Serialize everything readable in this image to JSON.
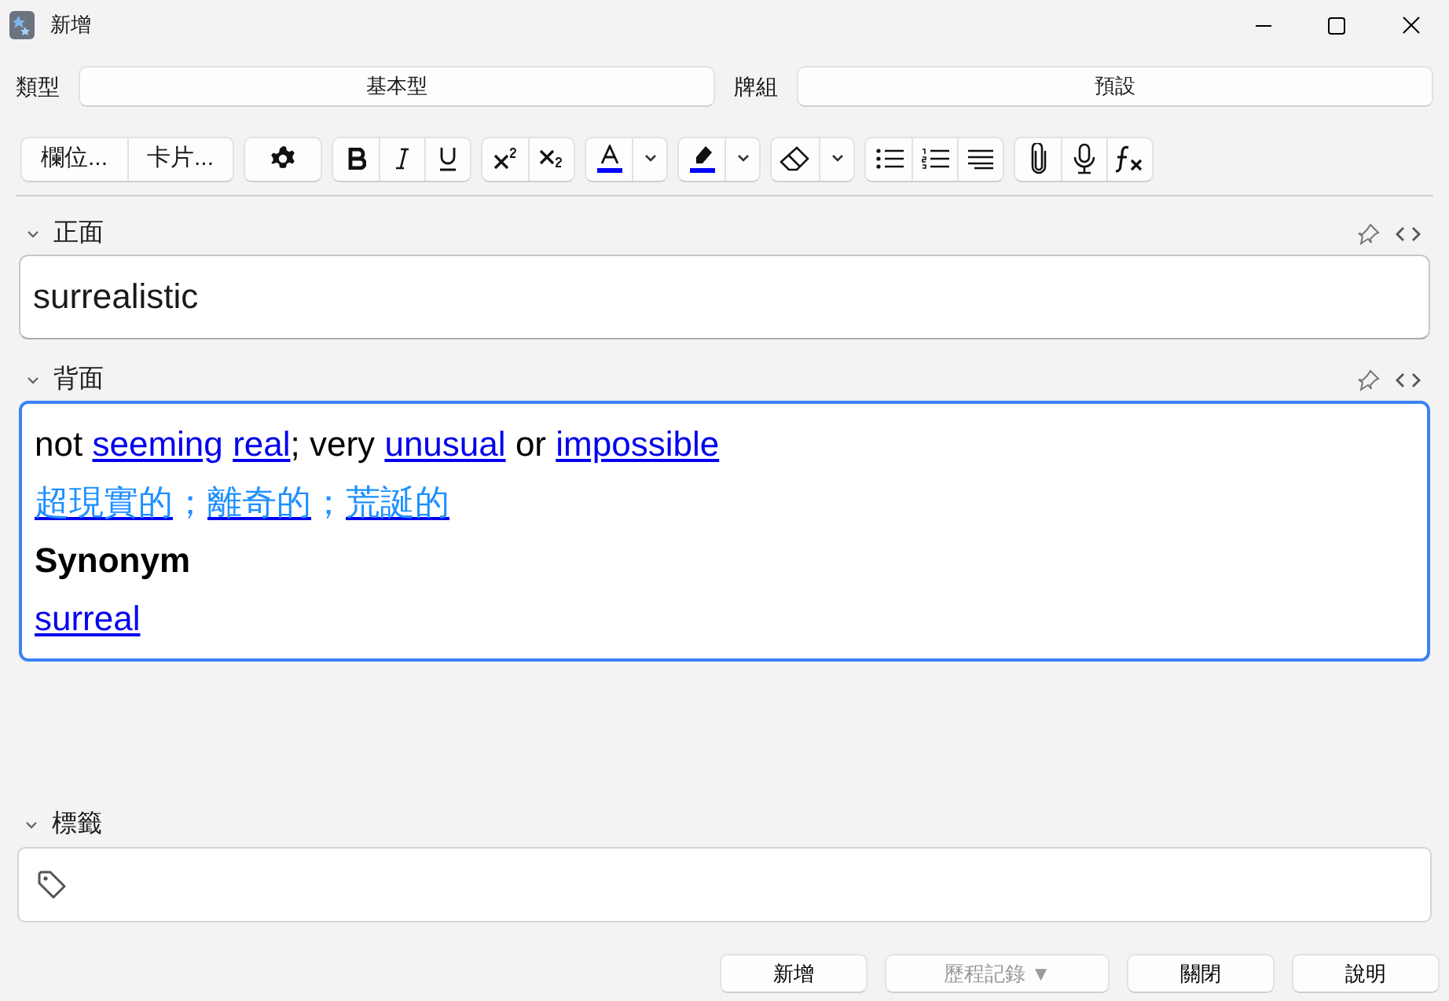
{
  "window": {
    "title": "新增"
  },
  "note_type": {
    "label": "類型",
    "value": "基本型"
  },
  "deck": {
    "label": "牌組",
    "value": "預設"
  },
  "toolbar": {
    "buttons": [
      "欄位...",
      "卡片..."
    ]
  },
  "fields": [
    {
      "label": "正面",
      "expanded": true,
      "focused": false,
      "lines": [
        {
          "kind": "plain",
          "segments": [
            {
              "text": "surrealistic",
              "link": false
            }
          ]
        }
      ]
    },
    {
      "label": "背面",
      "expanded": true,
      "focused": true,
      "lines": [
        {
          "kind": "definition",
          "segments": [
            {
              "text": "not",
              "link": false
            },
            {
              "text": "seeming",
              "link": true
            },
            {
              "text": "real",
              "link": true
            },
            {
              "text": "; very",
              "link": false
            },
            {
              "text": "unusual",
              "link": true
            },
            {
              "text": "or",
              "link": false
            },
            {
              "text": "impossible",
              "link": true
            }
          ]
        },
        {
          "kind": "translation",
          "segments": [
            {
              "text": "超現實的",
              "link": true
            },
            {
              "text": "；",
              "link": false
            },
            {
              "text": "離奇的",
              "link": true
            },
            {
              "text": "；",
              "link": false
            },
            {
              "text": "荒誕的",
              "link": true
            }
          ]
        },
        {
          "kind": "heading",
          "segments": [
            {
              "text": "Synonym",
              "link": false
            }
          ]
        },
        {
          "kind": "definition",
          "segments": [
            {
              "text": "surreal",
              "link": true
            }
          ]
        }
      ]
    }
  ],
  "tags": {
    "label": "標籤",
    "expanded": true
  },
  "buttons": [
    {
      "label": "新增",
      "disabled": false
    },
    {
      "label": "歷程記錄 ▼",
      "disabled": true
    },
    {
      "label": "關閉",
      "disabled": false
    },
    {
      "label": "說明",
      "disabled": false
    }
  ]
}
